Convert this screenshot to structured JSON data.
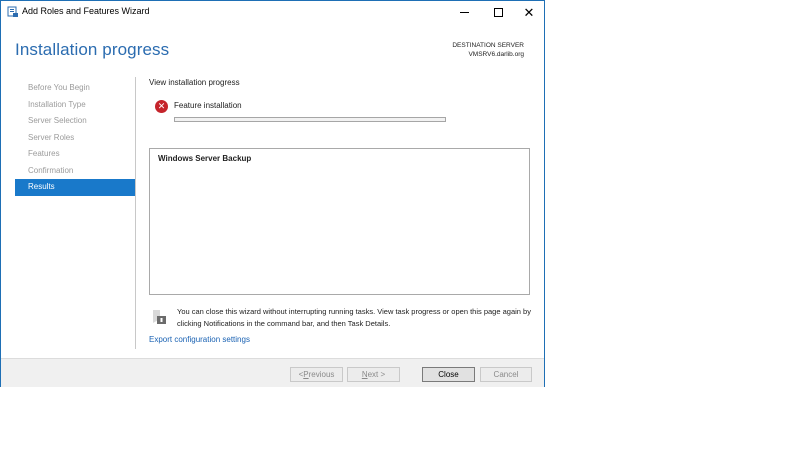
{
  "window": {
    "title": "Add Roles and Features Wizard"
  },
  "header": {
    "page_title": "Installation progress",
    "destination_label": "DESTINATION SERVER",
    "destination_value": "VMSRV6.darlib.org"
  },
  "sidebar": {
    "items": [
      {
        "label": "Before You Begin",
        "active": false
      },
      {
        "label": "Installation Type",
        "active": false
      },
      {
        "label": "Server Selection",
        "active": false
      },
      {
        "label": "Server Roles",
        "active": false
      },
      {
        "label": "Features",
        "active": false
      },
      {
        "label": "Confirmation",
        "active": false
      },
      {
        "label": "Results",
        "active": true
      }
    ]
  },
  "main": {
    "heading": "View installation progress",
    "status_label": "Feature installation",
    "status_icon": "error-icon",
    "progress_percent": 0,
    "results": [
      "Windows Server Backup"
    ],
    "notice": "You can close this wizard without interrupting running tasks. View task progress or open this page again by clicking Notifications in the command bar, and then Task Details.",
    "export_link": "Export configuration settings"
  },
  "footer": {
    "previous_label_prefix": "< ",
    "previous_label_accel": "P",
    "previous_label_rest": "revious",
    "next_label_accel": "N",
    "next_label_rest": "ext >",
    "close_label": "Close",
    "cancel_label": "Cancel"
  },
  "colors": {
    "accent": "#1979ca",
    "title_blue": "#2b6cb0",
    "error_red": "#c5242b",
    "link": "#1a62b3"
  }
}
